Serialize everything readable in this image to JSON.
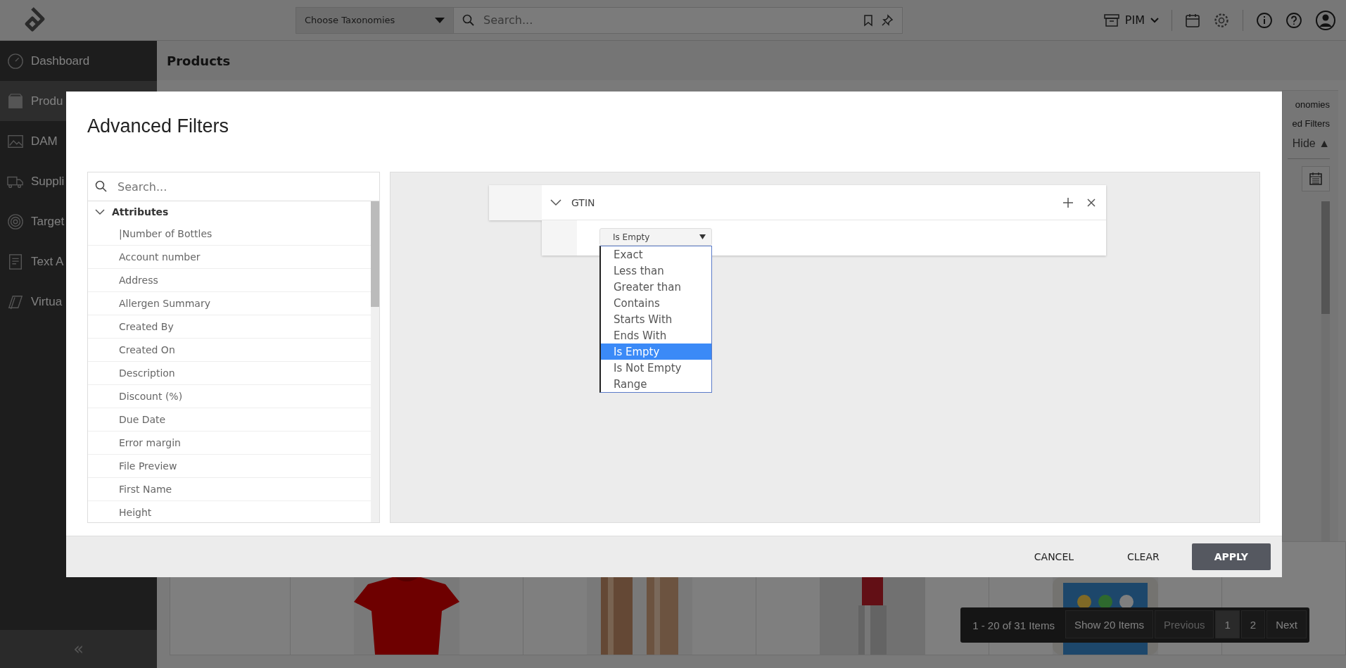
{
  "topbar": {
    "taxonomy_select": "Choose Taxonomies",
    "search": {
      "placeholder": "Search..."
    },
    "workspace": "PIM"
  },
  "sidebar": {
    "items": [
      {
        "label": "Dashboard",
        "selected": false
      },
      {
        "label": "Produ",
        "selected": true
      },
      {
        "label": "DAM",
        "selected": false
      },
      {
        "label": "Suppli",
        "selected": false
      },
      {
        "label": "Target",
        "selected": false
      },
      {
        "label": "Text A",
        "selected": false
      },
      {
        "label": "Virtua",
        "selected": false
      }
    ],
    "collapse": "«"
  },
  "page": {
    "title": "Products",
    "side_panel": [
      "onomies",
      "ed Filters"
    ],
    "hide_toggle": "Hide ▲",
    "products": [
      {
        "kind": "empty"
      },
      {
        "kind": "picture"
      },
      {
        "kind": "picture"
      },
      {
        "kind": "picture"
      },
      {
        "kind": "picture"
      }
    ],
    "pagination": {
      "summary": "1 - 20 of 31 Items",
      "page_size": "Show 20 Items",
      "previous": {
        "label": "Previous",
        "disabled": true
      },
      "pages": [
        {
          "label": "1",
          "selected": true
        },
        {
          "label": "2",
          "selected": false
        }
      ],
      "next": {
        "label": "Next",
        "disabled": false
      }
    }
  },
  "dialog": {
    "title": "Advanced Filters",
    "search": {
      "placeholder": "Search..."
    },
    "tree": {
      "label": "Attributes",
      "expanded": true,
      "children": [
        "|Number of Bottles",
        "Account number",
        "Address",
        "Allergen Summary",
        "Created By",
        "Created On",
        "Description",
        "Discount (%)",
        "Due Date",
        "Error margin",
        "File Preview",
        "First Name",
        "Height"
      ]
    },
    "filter": {
      "field": "GTIN",
      "expanded": true,
      "operator": "Is Empty",
      "options": [
        {
          "label": "Exact",
          "selected": false
        },
        {
          "label": "Less than",
          "selected": false
        },
        {
          "label": "Greater than",
          "selected": false
        },
        {
          "label": "Contains",
          "selected": false
        },
        {
          "label": "Starts With",
          "selected": false
        },
        {
          "label": "Ends With",
          "selected": false
        },
        {
          "label": "Is Empty",
          "selected": true
        },
        {
          "label": "Is Not Empty",
          "selected": false
        },
        {
          "label": "Range",
          "selected": false
        }
      ]
    },
    "buttons": [
      {
        "label": "CANCEL",
        "kind": "text"
      },
      {
        "label": "CLEAR",
        "kind": "text"
      },
      {
        "label": "APPLY",
        "kind": "primary"
      }
    ]
  }
}
